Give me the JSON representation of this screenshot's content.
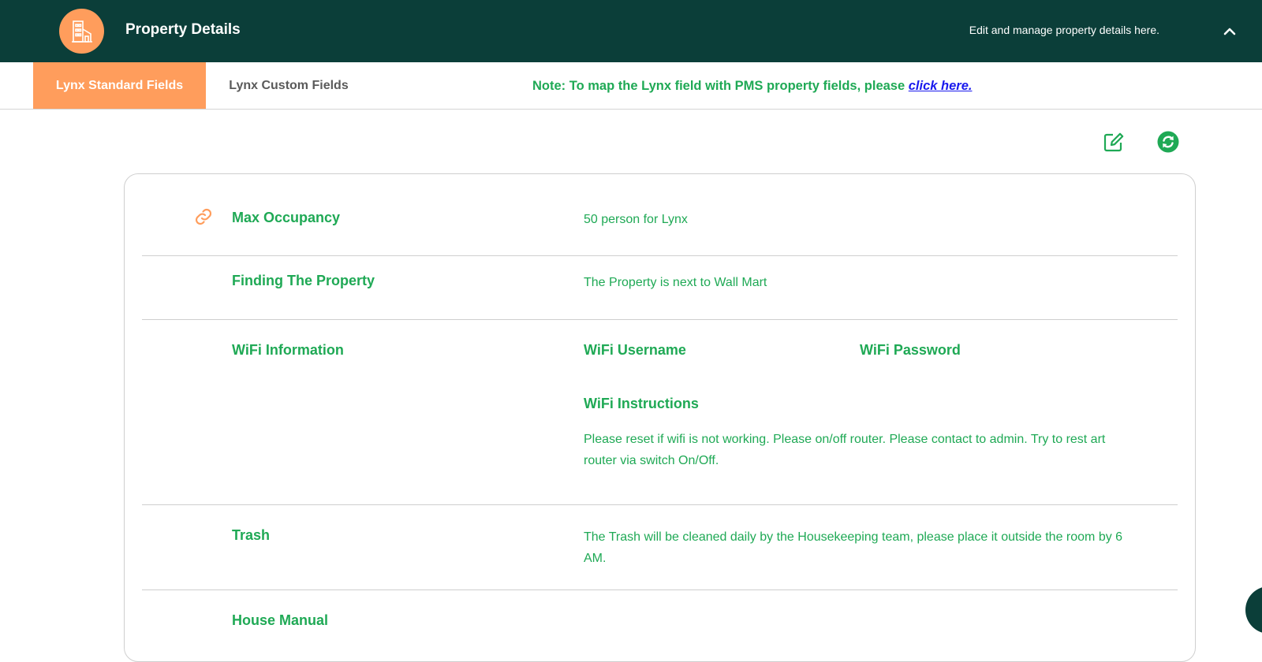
{
  "header": {
    "title": "Property Details",
    "subtitle": "Edit and manage property details here.",
    "icon": "building-icon",
    "collapse_icon": "chevron-up-icon"
  },
  "tabs": [
    {
      "label": "Lynx Standard Fields",
      "active": true
    },
    {
      "label": "Lynx Custom Fields",
      "active": false
    }
  ],
  "note": {
    "text": "Note: To map the Lynx field with PMS property fields, please ",
    "link": "click here."
  },
  "actions": {
    "edit_icon": "edit-icon",
    "sync_icon": "sync-icon"
  },
  "fields": {
    "max_occupancy": {
      "label": "Max Occupancy",
      "value": "50 person for Lynx",
      "icon": "link-icon"
    },
    "finding": {
      "label": "Finding The Property",
      "value": "The Property is next to Wall Mart"
    },
    "wifi": {
      "label": "WiFi Information",
      "username_label": "WiFi Username",
      "password_label": "WiFi Password",
      "instructions_label": "WiFi Instructions",
      "instructions": "Please reset if wifi is not working. Please on/off router. Please contact to admin. Try to rest art router via switch On/Off."
    },
    "trash": {
      "label": "Trash",
      "value": "The Trash will be cleaned daily by the Housekeeping team, please place it outside the room by 6 AM."
    },
    "house_manual": {
      "label": "House Manual"
    }
  },
  "colors": {
    "header_bg": "#0b3e39",
    "accent_orange": "#ff9d5c",
    "text_green": "#1fa955",
    "link_blue": "#1a1aee"
  }
}
